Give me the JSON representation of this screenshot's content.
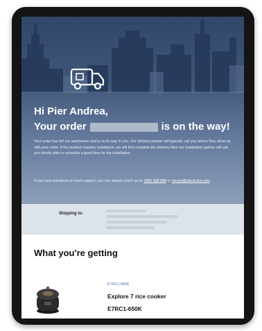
{
  "email": {
    "greeting": "Hi Pier Andrea,",
    "order_prefix": "Your order",
    "order_suffix": "is on the way!",
    "paragraph1": "Your order has left our warehouse and is on its way to you. Our delivery partner will typically call you before they show up with your order. If the product requires installation, we will first complete the delivery then our installation partner will call you shortly after to schedule a good time for the installation.",
    "paragraph2_prefix": "If you have questions or need support, you can always reach us on",
    "support_phone": "1800 588 888",
    "paragraph2_or": "or",
    "support_email": "vncare@electrolux.com",
    "shipping_label": "Shipping to:",
    "section_title": "What you're getting",
    "product": {
      "sku": "E7RC1-650K",
      "name": "Explore 7 rice cooker",
      "model": "E7RC1-650K"
    }
  },
  "icons": [
    "delivery-truck-icon",
    "rice-cooker-image"
  ],
  "colors": {
    "hero_top": "#31476a",
    "hero_bottom": "#8da0ba",
    "shipping_band": "#dde3ea",
    "sku_color": "#4a6aa8"
  }
}
